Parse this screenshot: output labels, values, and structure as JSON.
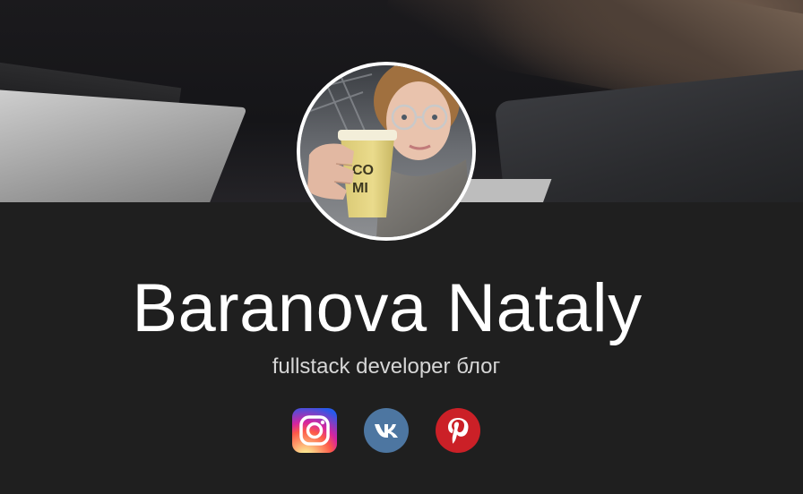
{
  "profile": {
    "name": "Baranova Nataly",
    "subtitle": "fullstack developer блог"
  },
  "avatar": {
    "cup_text_line1": "CO",
    "cup_text_line2": "MI"
  },
  "social": [
    {
      "name": "instagram",
      "icon": "instagram-icon",
      "color": "#d6249f"
    },
    {
      "name": "vk",
      "icon": "vk-icon",
      "color": "#4d76a1"
    },
    {
      "name": "pinterest",
      "icon": "pinterest-icon",
      "color": "#cb2027"
    }
  ],
  "colors": {
    "background": "#1f1f1f",
    "name_text": "#ffffff",
    "subtitle_text": "#d6d6d6"
  }
}
